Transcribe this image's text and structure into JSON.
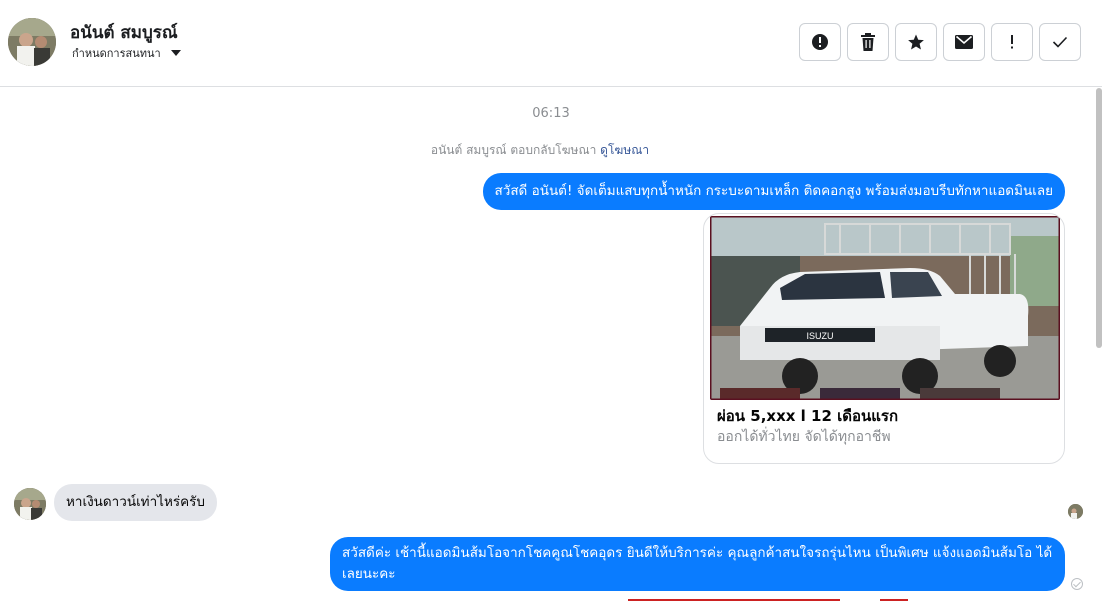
{
  "header": {
    "contact_name": "อนันต์ สมบูรณ์",
    "assign_label": "กำหนดการสนทนา"
  },
  "toolbar": {
    "buttons": [
      {
        "icon": "alert-circle-icon"
      },
      {
        "icon": "trash-icon"
      },
      {
        "icon": "star-icon"
      },
      {
        "icon": "mail-icon"
      },
      {
        "icon": "exclamation-icon"
      },
      {
        "icon": "check-icon"
      }
    ]
  },
  "thread": {
    "timestamp": "06:13",
    "system_note": "อนันต์ สมบูรณ์ ตอบกลับโฆษณา",
    "system_link": "ดูโฆษณา",
    "messages": [
      {
        "from": "page",
        "text": "สวัสดี อนันต์! จัดเต็มแสบทุกน้ำหนัก กระบะดามเหล็ก ติดคอกสูง พร้อมส่งมอบรีบทักหาแอดมินเลย"
      },
      {
        "from": "page",
        "type": "ad_card",
        "title": "ผ่อน 5,xxx l 12 เดือนแรก",
        "subtitle": "ออกได้ทั่วไทย จัดได้ทุกอาชีพ",
        "image_brand": "ISUZU"
      },
      {
        "from": "user",
        "text": "หาเงินดาวน์เท่าไหร่ครับ"
      },
      {
        "from": "page",
        "text": "สวัสดีค่ะ เช้านี้แอดมินส้มโอจากโชคคูณโชคอุดร ยินดีให้บริการค่ะ   คุณลูกค้าสนใจรถรุ่นไหน เป็นพิเศษ แจ้งแอดมินส้มโอ ได้เลยนะคะ"
      }
    ]
  },
  "colors": {
    "outgoing_bubble": "#0a7cff",
    "incoming_bubble": "#e4e6eb",
    "link": "#385898",
    "muted_text": "#8a8d91"
  }
}
